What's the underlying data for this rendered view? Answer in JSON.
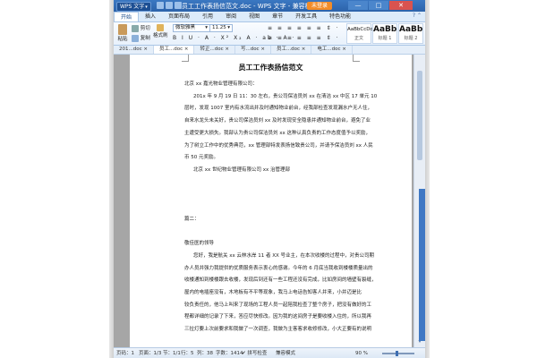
{
  "titlebar": {
    "app_logo": "WPS 文字",
    "title": "员工工作表扬信范文.doc - WPS 文字 - 兼容模式",
    "login_label": "未登录",
    "window_buttons": [
      "—",
      "□",
      "✕"
    ]
  },
  "menu": {
    "items": [
      "开始",
      "插入",
      "页面布局",
      "引用",
      "审阅",
      "视图",
      "章节",
      "开发工具",
      "特色功能"
    ],
    "active_index": 0,
    "right_icons": "? ⌃"
  },
  "ribbon": {
    "paste_label": "粘贴",
    "cut_label": "剪切",
    "copy_label": "复制",
    "format_painter_label": "格式刷",
    "font_name": "微软雅黑",
    "font_size": "11.25",
    "format_row": "B I U · A · X² X₂ A · ab · A ·",
    "align_row": "≡ ≡ ≡ ≡ ≡ ≡ ⇕ ·",
    "styles": [
      {
        "sample": "AaBbCcDd",
        "name": "正文"
      },
      {
        "sample": "AaBb",
        "name": "标题 1"
      },
      {
        "sample": "AaBb",
        "name": "标题 2"
      }
    ]
  },
  "doc_tabs": [
    "201...doc ×",
    "员工...doc ×",
    "转正...doc ×",
    "写...doc ×",
    "员工...doc ×",
    "电工...doc ×"
  ],
  "doc_tabs_active": 1,
  "document": {
    "title": "员工工作表扬信范文",
    "lines": [
      {
        "text": "北京 xx 嘉光物业管理有限公司：",
        "indent": false
      },
      {
        "text": "201x 年 9 月 19 日 11：30 左右，贵公司保洁员刘 xx 在清洁 xx 中区 17 单元 10",
        "indent": true
      },
      {
        "text": "层时，发现 1007 室内有水流出并及时通知物业前台，经我部检查发现漏水户无人住，",
        "indent": false
      },
      {
        "text": "自来水龙头未关好，贵公司保洁员刘 xx 及时发现安全隐患并通知物业前台，避免了业",
        "indent": false
      },
      {
        "text": "主遭受更大损失。我部认为贵公司保洁员刘 xx 这种认真负责的工作态度值予以奖励，",
        "indent": false
      },
      {
        "text": "为了树立工作中的优秀典范，xx 管理部特发表扬信致贵公司，并请予保洁员刘 xx 人民",
        "indent": false
      },
      {
        "text": "币 50 元奖励。",
        "indent": false
      },
      {
        "text": "北京 xx 世纪物业管理有限公司 xx 治管理部",
        "indent": true
      },
      {
        "text": "",
        "indent": false
      },
      {
        "text": "",
        "indent": false
      },
      {
        "text": "",
        "indent": false
      },
      {
        "text": "篇二：",
        "indent": false
      },
      {
        "text": "",
        "indent": false
      },
      {
        "text": "敬佳医的领导",
        "indent": false
      },
      {
        "text": "您好，我是航关 xx 云林水岸 11 者 XX 号业主，在本次收楼的过程中，对贵公司期",
        "indent": true
      },
      {
        "text": "办人员并强力我提供的优质服务表示衷心的感谢。今年的 6 月底当我收到楼楼质量出的",
        "indent": false
      },
      {
        "text": "收楼通知到楼楼跟去收楼，发现后到还有一些工程还没有完成，比如房间的墙壁有裂缝，",
        "indent": false
      },
      {
        "text": "屋内的电插座没有，木地板有不平等现象，我马上电话告知客人并来，小并迈是比",
        "indent": false
      },
      {
        "text": "较负责任的，他马上叫来了现场的工程人员一起陪我检查了整个房子，把没有做好的工",
        "indent": false
      },
      {
        "text": "程都详细的记录了下来，答应尽快修改。因为我的这间房子是要收楼入住的，所以我再",
        "indent": false
      },
      {
        "text": "三拉灯要上次前要求和我做了一次调查，我做为主客客求收修修改，小大正要有的说明",
        "indent": false
      }
    ]
  },
  "statusbar": {
    "page_num": "页码：1",
    "page_of": "页面：1/3",
    "section": "节：1/1",
    "position": "行：5",
    "column": "列：38",
    "word_count": "字数：1414",
    "spell": "✔ 拼写检查",
    "mode": "兼容模式",
    "zoom": "90 %",
    "zoom_level": 0.45
  }
}
